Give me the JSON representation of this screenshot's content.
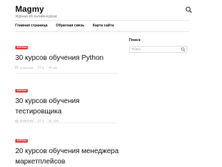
{
  "header": {
    "site_title": "Magmy",
    "site_description": "Журнал об онлайн-курсах"
  },
  "nav": {
    "items": [
      {
        "label": "Главная страница"
      },
      {
        "label": "Обратная связь"
      },
      {
        "label": "Карта сайта"
      }
    ]
  },
  "posts": [
    {
      "category": "КУРСЫ",
      "title": "30 курсов обучения Python",
      "date": "13.08.2022",
      "comments": "0",
      "views": "94"
    },
    {
      "category": "КУРСЫ",
      "title": "30 курсов обучения тестировщика",
      "date": "13.08.2022",
      "comments": "0",
      "views": "105"
    },
    {
      "category": "КУРСЫ",
      "title": "20 курсов обучения менеджера маркетплейсов"
    }
  ],
  "sidebar": {
    "search_title": "Поиск",
    "search_placeholder": "Поиск..."
  },
  "colors": {
    "accent": "#e83a3a",
    "text": "#111111",
    "muted": "#999999"
  }
}
